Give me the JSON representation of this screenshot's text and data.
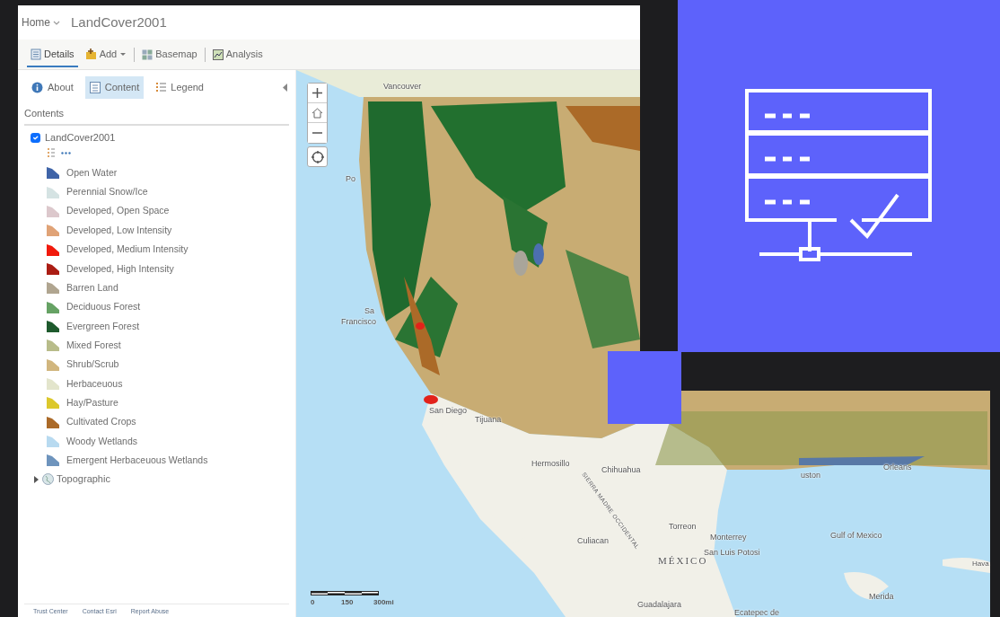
{
  "header": {
    "home": "Home",
    "title": "LandCover2001"
  },
  "toolbar": [
    {
      "label": "Details",
      "selected": true,
      "dropdown": false
    },
    {
      "label": "Add",
      "selected": false,
      "dropdown": true
    },
    {
      "label": "Basemap",
      "selected": false,
      "dropdown": false
    },
    {
      "label": "Analysis",
      "selected": false,
      "dropdown": false
    }
  ],
  "panel_tabs": [
    {
      "label": "About",
      "selected": false
    },
    {
      "label": "Content",
      "selected": true
    },
    {
      "label": "Legend",
      "selected": false
    }
  ],
  "contents_heading": "Contents",
  "layers": [
    {
      "kind": "feature",
      "name": "LandCover2001",
      "checked": true,
      "legend": [
        {
          "label": "Open Water",
          "color": "#3f64a8"
        },
        {
          "label": "Perennial Snow/Ice",
          "color": "#d5e3e3"
        },
        {
          "label": "Developed, Open Space",
          "color": "#dcc8cc"
        },
        {
          "label": "Developed, Low Intensity",
          "color": "#e0a377"
        },
        {
          "label": "Developed, Medium Intensity",
          "color": "#f11a0c"
        },
        {
          "label": "Developed, High Intensity",
          "color": "#ab1d14"
        },
        {
          "label": "Barren Land",
          "color": "#b0a590"
        },
        {
          "label": "Deciduous Forest",
          "color": "#66a264"
        },
        {
          "label": "Evergreen Forest",
          "color": "#1e5a2d"
        },
        {
          "label": "Mixed Forest",
          "color": "#b8bc8a"
        },
        {
          "label": "Shrub/Scrub",
          "color": "#d1b67e"
        },
        {
          "label": "Herbaceuous",
          "color": "#e3e5cc"
        },
        {
          "label": "Hay/Pasture",
          "color": "#dcc82c"
        },
        {
          "label": "Cultivated Crops",
          "color": "#ab6a28"
        },
        {
          "label": "Woody Wetlands",
          "color": "#b8daf0"
        },
        {
          "label": "Emergent Herbaceuous Wetlands",
          "color": "#6e94bd"
        }
      ]
    },
    {
      "kind": "basemap",
      "name": "Topographic",
      "expanded": false
    }
  ],
  "footer_links": [
    "Trust Center",
    "Contact Esri",
    "Report Abuse"
  ],
  "map": {
    "labels": [
      "Vancouver",
      "Po",
      "Sa",
      "Francisco",
      "San Diego",
      "Tijuana",
      "Hermosillo",
      "Chihuahua",
      "SIERRA MADRE OCCIDENTAL",
      "Torreon",
      "Culiacan",
      "Monterrey",
      "MÉXICO",
      "San Luis Potosi",
      "Guadalajara",
      "Ecatepec de",
      "uston",
      "Orleans",
      "Gulf of Mexico",
      "Merida",
      "Hava"
    ],
    "scale_labels": [
      "0",
      "150",
      "300mi"
    ]
  }
}
